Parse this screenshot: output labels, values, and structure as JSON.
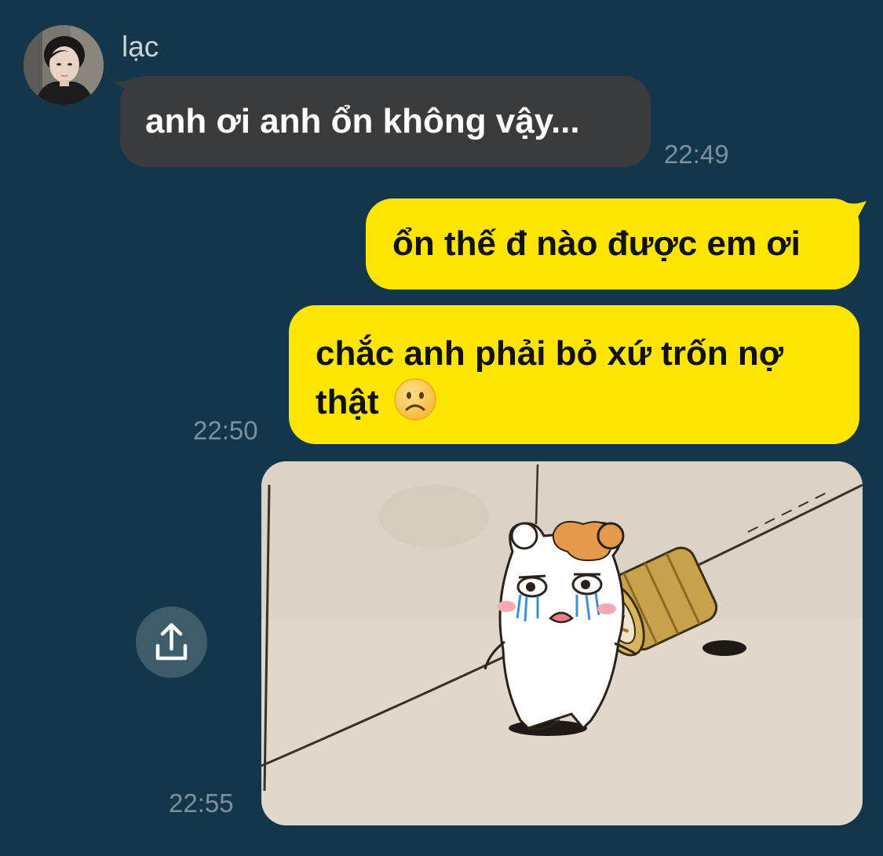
{
  "chat": {
    "sender_name": "lạc",
    "avatar_icon": "person-photo-avatar",
    "messages": [
      {
        "direction": "incoming",
        "text": "anh ơi anh ổn không vậy...",
        "time": "22:49"
      },
      {
        "direction": "outgoing",
        "text": "ổn thế đ nào được em ơi"
      },
      {
        "direction": "outgoing",
        "text_line1": "chắc anh phải bỏ xứ trốn nợ",
        "text_line2": "thật",
        "emoji": "frowning-face-emoji",
        "time": "22:50"
      },
      {
        "direction": "outgoing",
        "type": "image-sticker",
        "image_subject": "crying-hamster-cartoon",
        "time": "22:55"
      }
    ],
    "share_icon": "share-upload-icon"
  },
  "colors": {
    "background": "#14364a",
    "incoming_bubble": "#3a3b3d",
    "outgoing_bubble": "#fee500",
    "time_text": "#7c909e",
    "share_button": "#3f5c6c"
  }
}
